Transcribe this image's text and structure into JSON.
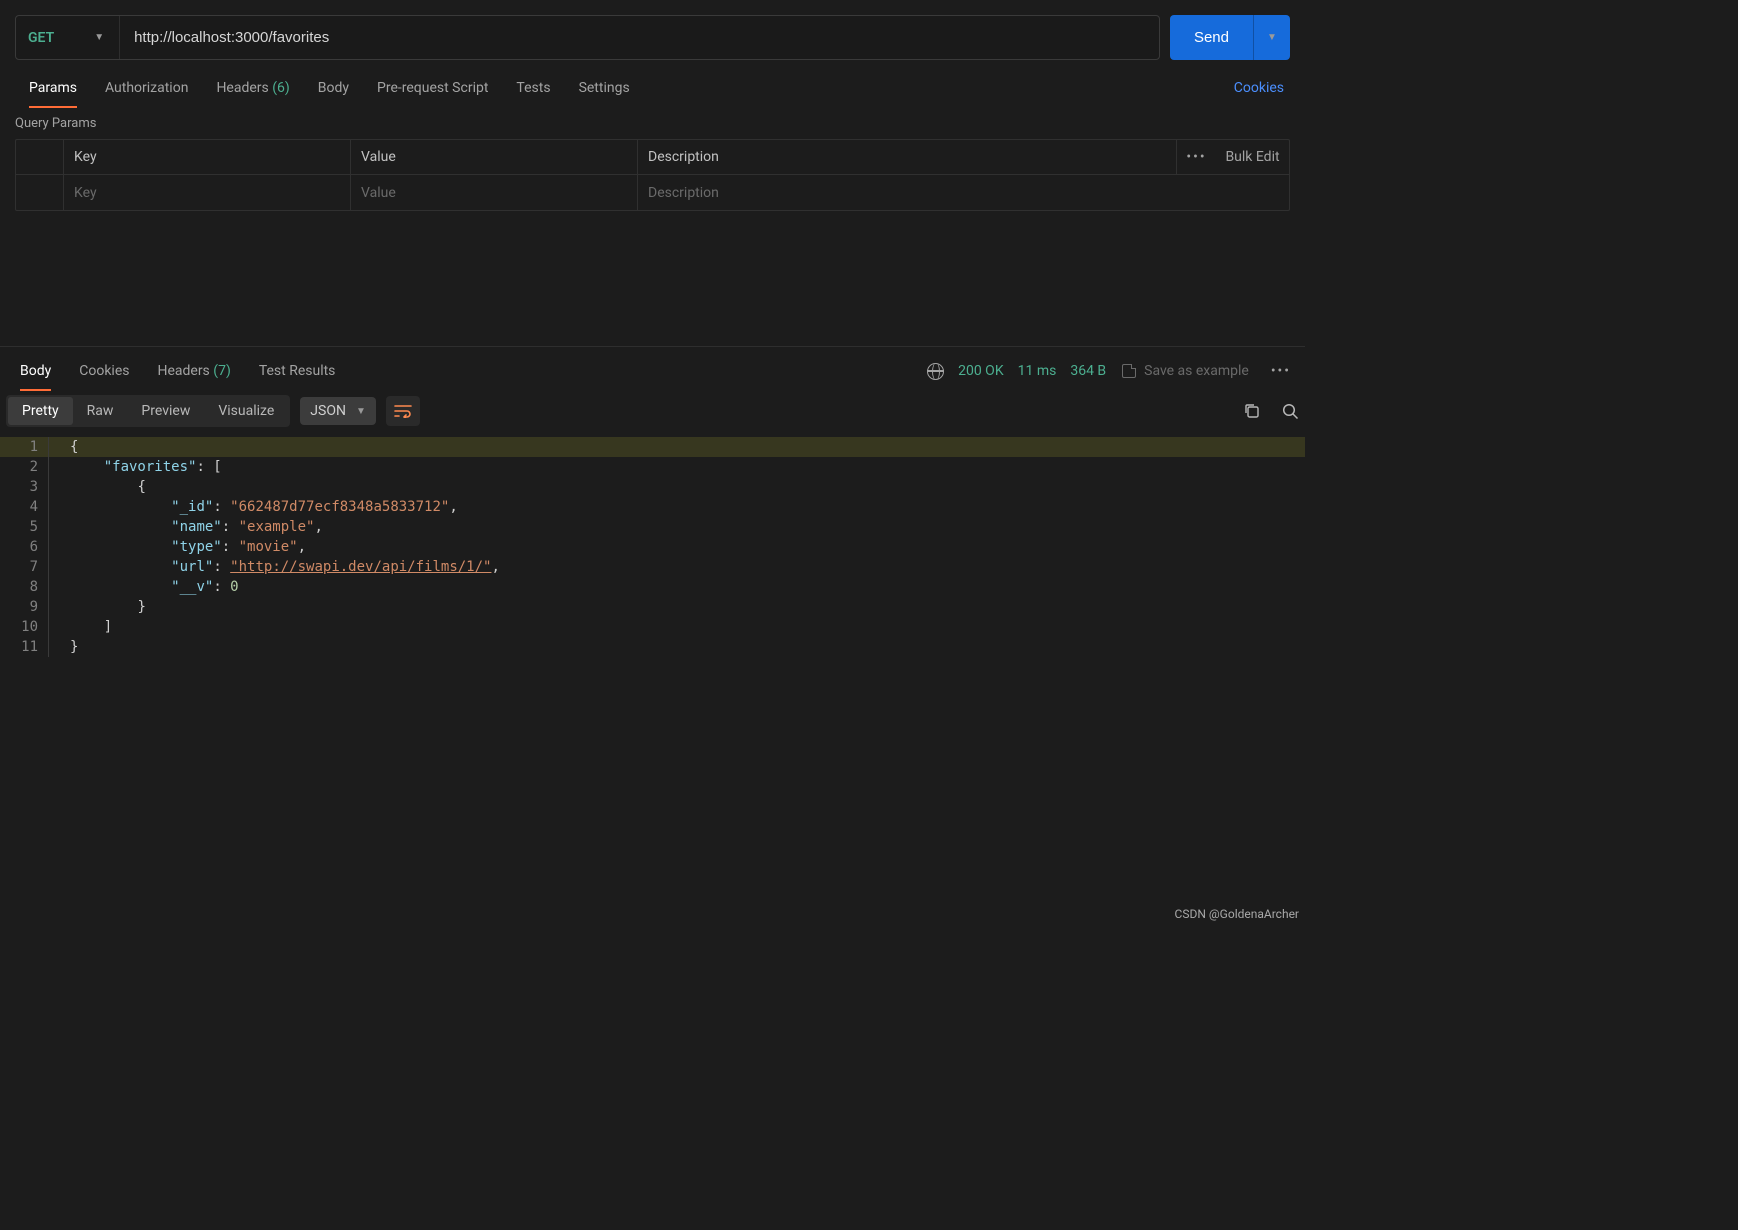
{
  "request": {
    "method": "GET",
    "url": "http://localhost:3000/favorites",
    "send_label": "Send"
  },
  "req_tabs": {
    "params": "Params",
    "auth": "Authorization",
    "headers": "Headers",
    "headers_count": "(6)",
    "body": "Body",
    "prereq": "Pre-request Script",
    "tests": "Tests",
    "settings": "Settings",
    "cookies_link": "Cookies"
  },
  "params_section": {
    "label": "Query Params",
    "hdr_key": "Key",
    "hdr_val": "Value",
    "hdr_desc": "Description",
    "bulk_edit": "Bulk Edit",
    "ph_key": "Key",
    "ph_val": "Value",
    "ph_desc": "Description"
  },
  "resp_tabs": {
    "body": "Body",
    "cookies": "Cookies",
    "headers": "Headers",
    "headers_count": "(7)",
    "tests": "Test Results"
  },
  "status": {
    "code_text": "200 OK",
    "time": "11 ms",
    "size": "364 B",
    "save_example": "Save as example"
  },
  "view": {
    "pretty": "Pretty",
    "raw": "Raw",
    "preview": "Preview",
    "visualize": "Visualize",
    "format": "JSON"
  },
  "response_body": {
    "_id": "662487d77ecf8348a5833712",
    "name": "example",
    "type": "movie",
    "url": "http://swapi.dev/api/films/1/",
    "__v": 0
  },
  "watermark": "CSDN @GoldenaArcher"
}
